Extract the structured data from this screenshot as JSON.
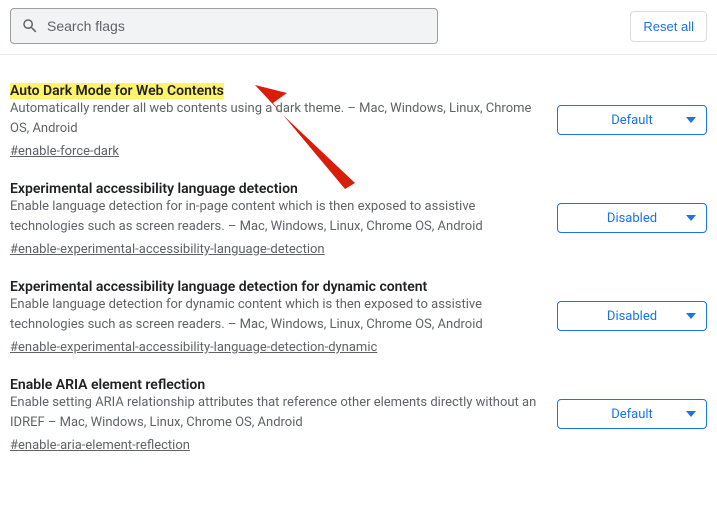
{
  "search": {
    "placeholder": "Search flags"
  },
  "reset_label": "Reset all",
  "flags": [
    {
      "title": "Auto Dark Mode for Web Contents",
      "highlighted": true,
      "desc": "Automatically render all web contents using a dark theme. – Mac, Windows, Linux, Chrome OS, Android",
      "link": "#enable-force-dark",
      "value": "Default"
    },
    {
      "title": "Experimental accessibility language detection",
      "highlighted": false,
      "desc": "Enable language detection for in-page content which is then exposed to assistive technologies such as screen readers. – Mac, Windows, Linux, Chrome OS, Android",
      "link": "#enable-experimental-accessibility-language-detection",
      "value": "Disabled"
    },
    {
      "title": "Experimental accessibility language detection for dynamic content",
      "highlighted": false,
      "desc": "Enable language detection for dynamic content which is then exposed to assistive technologies such as screen readers. – Mac, Windows, Linux, Chrome OS, Android",
      "link": "#enable-experimental-accessibility-language-detection-dynamic",
      "value": "Disabled"
    },
    {
      "title": "Enable ARIA element reflection",
      "highlighted": false,
      "desc": "Enable setting ARIA relationship attributes that reference other elements directly without an IDREF – Mac, Windows, Linux, Chrome OS, Android",
      "link": "#enable-aria-element-reflection",
      "value": "Default"
    }
  ]
}
